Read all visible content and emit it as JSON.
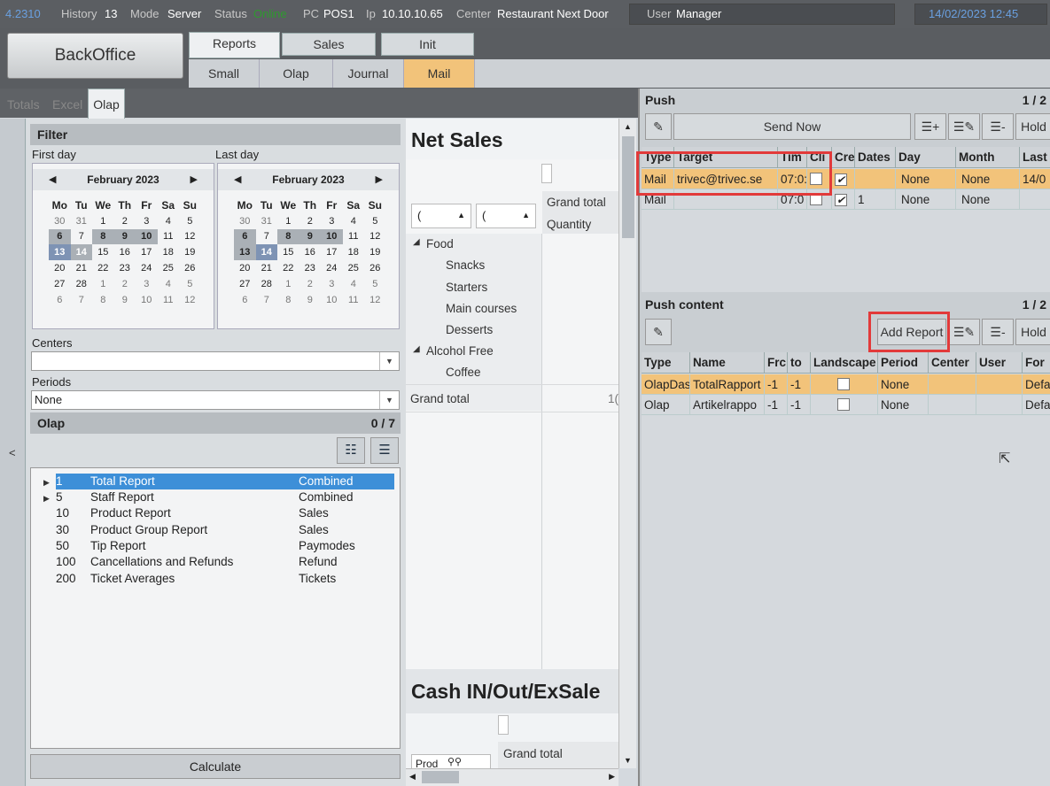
{
  "topbar": {
    "version": "4.2310",
    "history_label": "History",
    "history_value": "13",
    "mode_label": "Mode",
    "mode_value": "Server",
    "status_label": "Status",
    "status_value": "Online",
    "pc_label": "PC",
    "pc_value": "POS1",
    "ip_label": "Ip",
    "ip_value": "10.10.10.65",
    "center_label": "Center",
    "center_value": "Restaurant Next Door",
    "user_label": "User",
    "user_value": "Manager",
    "datetime": "14/02/2023 12:45"
  },
  "backoffice_label": "BackOffice",
  "main_tabs": [
    "Reports",
    "Sales",
    "Init"
  ],
  "sub_tabs": [
    "Small",
    "Olap",
    "Journal",
    "Mail"
  ],
  "left_tabs": [
    "Totals",
    "Excel",
    "Olap"
  ],
  "collapse_glyph": "<",
  "filter": {
    "title": "Filter",
    "first_day_label": "First day",
    "last_day_label": "Last day",
    "calendar_month": "February 2023",
    "day_names": [
      "Mo",
      "Tu",
      "We",
      "Th",
      "Fr",
      "Sa",
      "Su"
    ],
    "weeks": [
      [
        "30",
        "31",
        "1",
        "2",
        "3",
        "4",
        "5"
      ],
      [
        "6",
        "7",
        "8",
        "9",
        "10",
        "11",
        "12"
      ],
      [
        "13",
        "14",
        "15",
        "16",
        "17",
        "18",
        "19"
      ],
      [
        "20",
        "21",
        "22",
        "23",
        "24",
        "25",
        "26"
      ],
      [
        "27",
        "28",
        "1",
        "2",
        "3",
        "4",
        "5"
      ],
      [
        "6",
        "7",
        "8",
        "9",
        "10",
        "11",
        "12"
      ]
    ],
    "centers_label": "Centers",
    "centers_value": "",
    "periods_label": "Periods",
    "periods_value": "None"
  },
  "olap": {
    "title": "Olap",
    "count": "0 / 7",
    "rows": [
      {
        "id": "1",
        "name": "Total Report",
        "category": "Combined",
        "expandable": true
      },
      {
        "id": "5",
        "name": "Staff Report",
        "category": "Combined",
        "expandable": true
      },
      {
        "id": "10",
        "name": "Product Report",
        "category": "Sales",
        "expandable": false
      },
      {
        "id": "30",
        "name": "Product Group Report",
        "category": "Sales",
        "expandable": false
      },
      {
        "id": "50",
        "name": "Tip Report",
        "category": "Paymodes",
        "expandable": false
      },
      {
        "id": "100",
        "name": "Cancellations and Refunds",
        "category": "Refund",
        "expandable": false
      },
      {
        "id": "200",
        "name": "Ticket Averages",
        "category": "Tickets",
        "expandable": false
      }
    ],
    "calculate_label": "Calculate"
  },
  "pivot": {
    "net_sales_title": "Net Sales",
    "grand_total_header": "Grand total",
    "quantity_header": "Quantity",
    "filter1": "(",
    "filter2": "(",
    "food": "Food",
    "snacks": "Snacks",
    "starters": "Starters",
    "main_courses": "Main courses",
    "desserts": "Desserts",
    "alcohol_free": "Alcohol Free",
    "coffee": "Coffee",
    "grand_total_row": "Grand total",
    "grand_total_value": "1(",
    "cash_title": "Cash IN/Out/ExSale",
    "cash_grand_total": "Grand total",
    "cash_prod_field": "Prod"
  },
  "push": {
    "title": "Push",
    "count": "1 / 2",
    "send_now_label": "Send Now",
    "hold_label": "Hold",
    "columns": [
      "Type",
      "Target",
      "Tim",
      "Cli",
      "Cre",
      "Dates",
      "Day",
      "Month",
      "Last"
    ],
    "rows": [
      {
        "type": "Mail",
        "target": "trivec@trivec.se",
        "time": "07:0:",
        "cli": false,
        "cre": true,
        "dates": "",
        "day": "None",
        "month": "None",
        "last": "14/0"
      },
      {
        "type": "Mail",
        "target": "",
        "time": "07:0",
        "cli": false,
        "cre": true,
        "dates": "1",
        "day": "None",
        "month": "None",
        "last": ""
      }
    ]
  },
  "push_content": {
    "title": "Push content",
    "count": "1 / 2",
    "add_report_label": "Add Report",
    "hold_label": "Hold",
    "columns": [
      "Type",
      "Name",
      "Frc",
      "to",
      "Landscape",
      "Period",
      "Center",
      "User",
      "For"
    ],
    "rows": [
      {
        "type": "OlapDas",
        "name": "TotalRapport",
        "from": "-1",
        "to": "-1",
        "landscape": false,
        "period": "None",
        "center": "",
        "user": "",
        "format": "Defa"
      },
      {
        "type": "Olap",
        "name": "Artikelrappo",
        "from": "-1",
        "to": "-1",
        "landscape": false,
        "period": "None",
        "center": "",
        "user": "",
        "format": "Defa"
      }
    ]
  },
  "colors": {
    "accent": "#f2c37a",
    "highlight_box": "#e23a3a",
    "selection": "#3d8fd8",
    "online": "#2e9a2e"
  }
}
